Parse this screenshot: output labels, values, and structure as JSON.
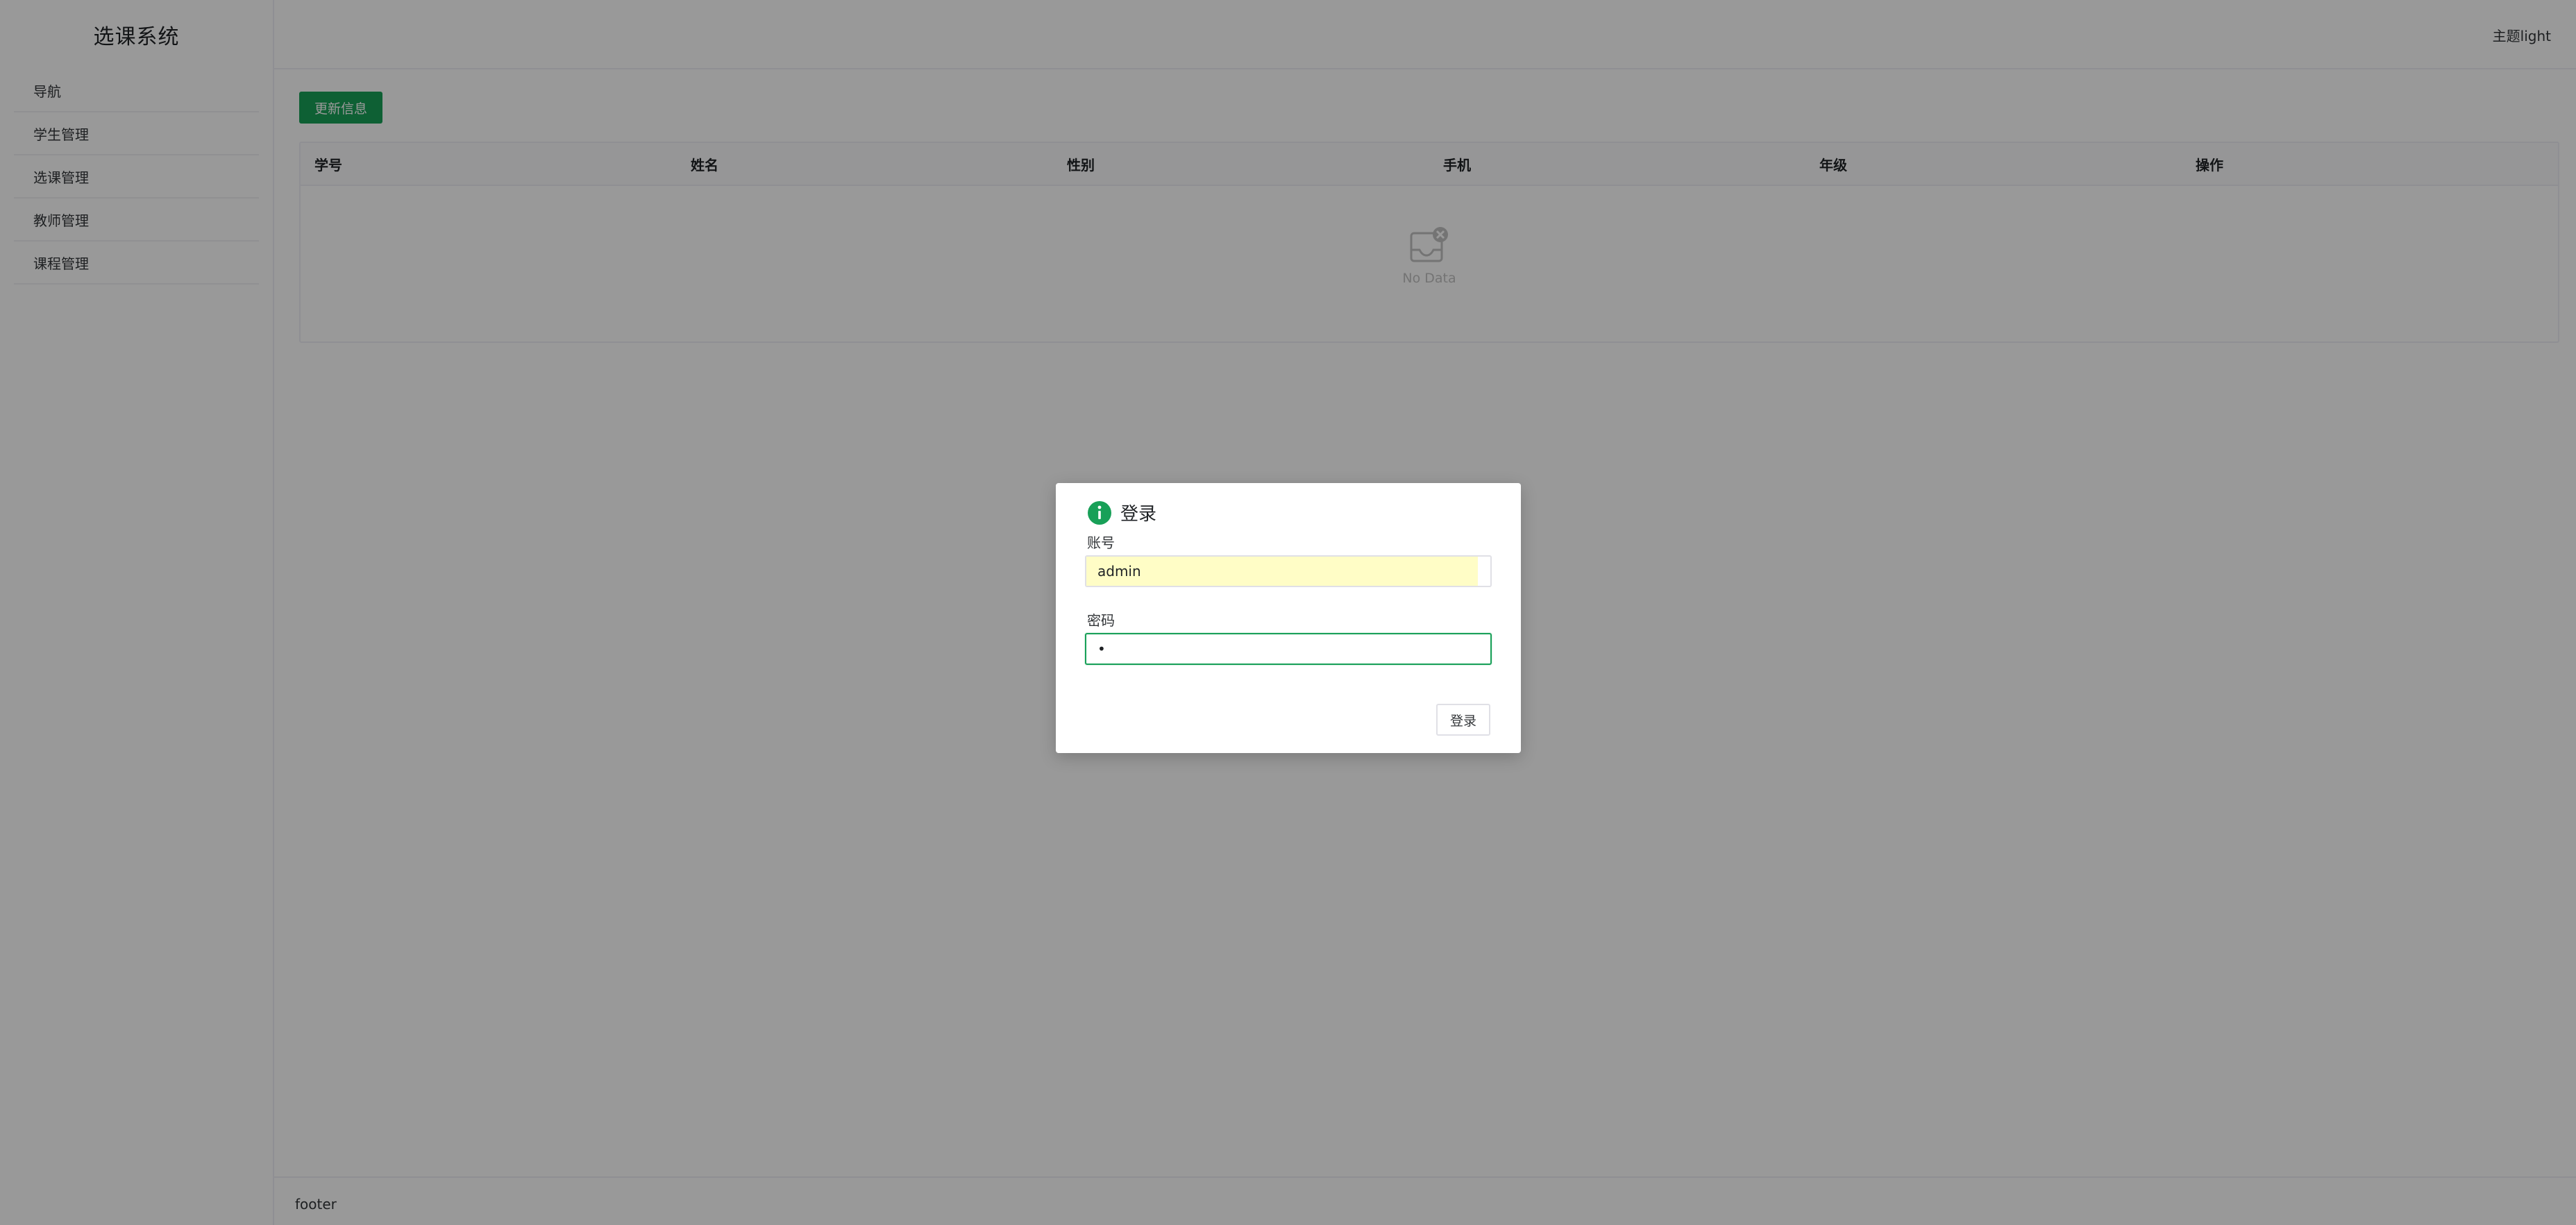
{
  "app": {
    "title": "选课系统"
  },
  "header": {
    "theme_toggle": "主题light"
  },
  "sidebar": {
    "items": [
      {
        "label": "导航"
      },
      {
        "label": "学生管理"
      },
      {
        "label": "选课管理"
      },
      {
        "label": "教师管理"
      },
      {
        "label": "课程管理"
      }
    ]
  },
  "toolbar": {
    "update_label": "更新信息"
  },
  "table": {
    "columns": [
      "学号",
      "姓名",
      "性别",
      "手机",
      "年级",
      "操作"
    ],
    "rows": [],
    "empty_text": "No Data"
  },
  "footer": {
    "text": "footer"
  },
  "dialog": {
    "title": "登录",
    "account_label": "账号",
    "account_value": "admin",
    "password_label": "密码",
    "password_value": "•",
    "submit_label": "登录"
  },
  "colors": {
    "accent": "#18a058",
    "autofill": "#fffdc6",
    "overlay": "rgba(0,0,0,0.4)"
  },
  "icons": {
    "dialog": "info-icon",
    "empty": "empty-inbox-icon"
  }
}
